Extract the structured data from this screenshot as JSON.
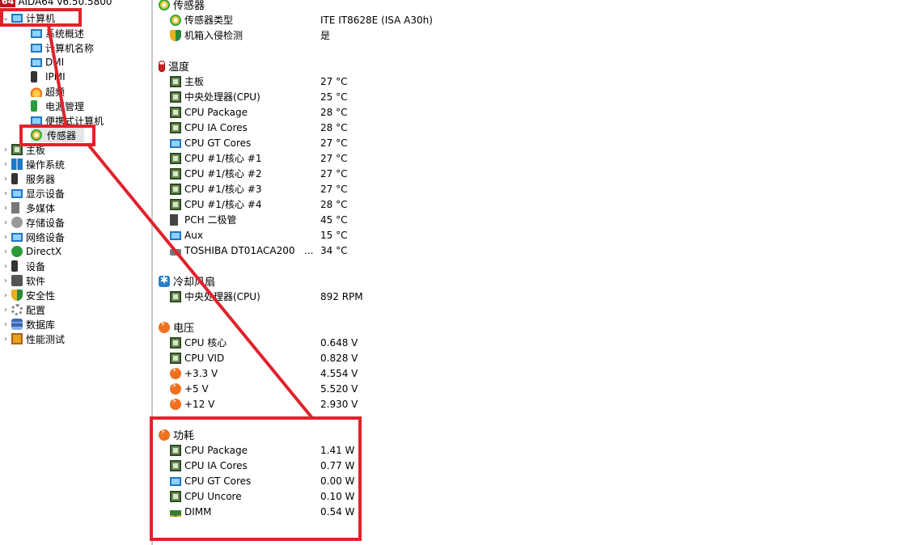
{
  "app": {
    "logo": "64",
    "title": "AIDA64 v6.50.5800"
  },
  "tree": {
    "root": "计算机",
    "children": [
      {
        "label": "系统概述",
        "icon": "monitor-icon"
      },
      {
        "label": "计算机名称",
        "icon": "monitor-icon"
      },
      {
        "label": "DMI",
        "icon": "monitor-icon"
      },
      {
        "label": "IPMI",
        "icon": "phone-icon"
      },
      {
        "label": "超频",
        "icon": "fire-icon"
      },
      {
        "label": "电源管理",
        "icon": "power-icon"
      },
      {
        "label": "便携式计算机",
        "icon": "laptop-icon"
      },
      {
        "label": "传感器",
        "icon": "sensor-icon"
      }
    ],
    "items": [
      {
        "label": "主板",
        "icon": "motherboard-icon"
      },
      {
        "label": "操作系统",
        "icon": "windows-icon"
      },
      {
        "label": "服务器",
        "icon": "server-icon"
      },
      {
        "label": "显示设备",
        "icon": "display-icon"
      },
      {
        "label": "多媒体",
        "icon": "speaker-icon"
      },
      {
        "label": "存储设备",
        "icon": "storage-icon"
      },
      {
        "label": "网络设备",
        "icon": "network-icon"
      },
      {
        "label": "DirectX",
        "icon": "xbox-icon"
      },
      {
        "label": "设备",
        "icon": "device-icon"
      },
      {
        "label": "软件",
        "icon": "software-icon"
      },
      {
        "label": "安全性",
        "icon": "shield-icon"
      },
      {
        "label": "配置",
        "icon": "config-icon"
      },
      {
        "label": "数据库",
        "icon": "database-icon"
      },
      {
        "label": "性能测试",
        "icon": "benchmark-icon"
      }
    ]
  },
  "sections": {
    "sensor": {
      "title": "传感器",
      "rows": [
        {
          "label": "传感器类型",
          "value": "ITE IT8628E  (ISA A30h)"
        },
        {
          "label": "机箱入侵检测",
          "value": "是"
        }
      ]
    },
    "temperature": {
      "title": "温度",
      "rows": [
        {
          "label": "主板",
          "value": "27 °C"
        },
        {
          "label": "中央处理器(CPU)",
          "value": "25 °C"
        },
        {
          "label": "CPU Package",
          "value": "28 °C"
        },
        {
          "label": "CPU IA Cores",
          "value": "28 °C"
        },
        {
          "label": "CPU GT Cores",
          "value": "27 °C"
        },
        {
          "label": "CPU #1/核心 #1",
          "value": "27 °C"
        },
        {
          "label": "CPU #1/核心 #2",
          "value": "27 °C"
        },
        {
          "label": "CPU #1/核心 #3",
          "value": "27 °C"
        },
        {
          "label": "CPU #1/核心 #4",
          "value": "28 °C"
        },
        {
          "label": "PCH 二极管",
          "value": "45 °C"
        },
        {
          "label": "Aux",
          "value": "15 °C"
        },
        {
          "label": "TOSHIBA DT01ACA200",
          "value": "34 °C",
          "ellipsis": "..."
        }
      ]
    },
    "fan": {
      "title": "冷却风扇",
      "rows": [
        {
          "label": "中央处理器(CPU)",
          "value": "892 RPM"
        }
      ]
    },
    "voltage": {
      "title": "电压",
      "rows": [
        {
          "label": "CPU 核心",
          "value": "0.648 V"
        },
        {
          "label": "CPU VID",
          "value": "0.828 V"
        },
        {
          "label": "+3.3 V",
          "value": "4.554 V"
        },
        {
          "label": "+5 V",
          "value": "5.520 V"
        },
        {
          "label": "+12 V",
          "value": "2.930 V"
        }
      ]
    },
    "power": {
      "title": "功耗",
      "rows": [
        {
          "label": "CPU Package",
          "value": "1.41 W"
        },
        {
          "label": "CPU IA Cores",
          "value": "0.77 W"
        },
        {
          "label": "CPU GT Cores",
          "value": "0.00 W"
        },
        {
          "label": "CPU Uncore",
          "value": "0.10 W"
        },
        {
          "label": "DIMM",
          "value": "0.54 W"
        }
      ]
    }
  },
  "colors": {
    "highlight": "#e0222c",
    "accent": "#1e78c8"
  }
}
